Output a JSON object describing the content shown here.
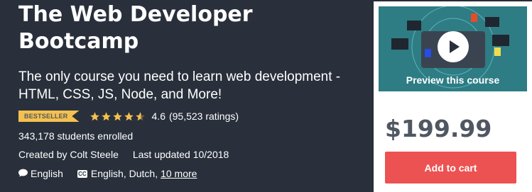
{
  "course": {
    "title": "The Web Developer Bootcamp",
    "subtitle": "The only course you need to learn web development - HTML, CSS, JS, Node, and More!",
    "badge": "BESTSELLER",
    "rating": "4.6",
    "rating_count": "(95,523 ratings)",
    "stars_filled": 4.6,
    "enrolled": "343,178 students enrolled",
    "created_by": "Created by Colt Steele",
    "last_updated": "Last updated 10/2018",
    "language": "English",
    "captions": "English, Dutch,",
    "captions_more": "10 more"
  },
  "card": {
    "preview_label": "Preview this course",
    "price": "$199.99",
    "cta": "Add to cart"
  },
  "colors": {
    "hero_bg": "#29303b",
    "badge": "#f4c150",
    "star": "#f4c150",
    "cta": "#ec5252",
    "preview_bg": "#2e7c84"
  },
  "icons": {
    "language": "speech-bubble-icon",
    "captions": "closed-captions-icon",
    "play": "play-icon"
  }
}
